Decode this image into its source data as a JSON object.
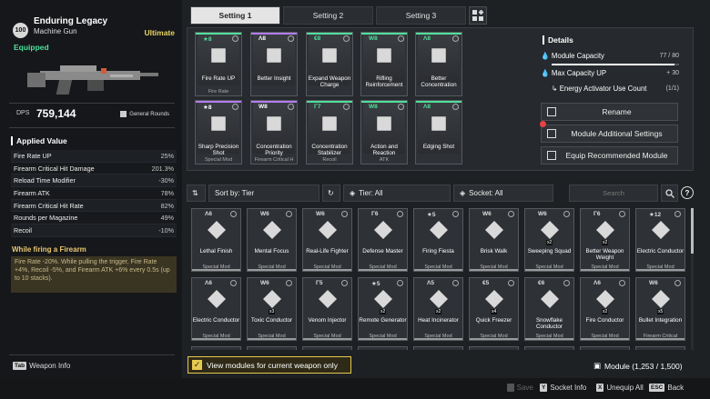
{
  "weapon": {
    "rank": "100",
    "name": "Enduring Legacy",
    "type": "Machine Gun",
    "tier": "Ultimate",
    "status": "Equipped",
    "dps_label": "DPS",
    "dps_value": "759,144",
    "ammo": "General Rounds"
  },
  "applied": {
    "title": "Applied Value",
    "stats": [
      {
        "label": "Fire Rate UP",
        "value": "25%"
      },
      {
        "label": "Firearm Critical Hit Damage",
        "value": "201.3%"
      },
      {
        "label": "Reload Time Modifier",
        "value": "-30%"
      },
      {
        "label": "Firearm ATK",
        "value": "78%"
      },
      {
        "label": "Firearm Critical Hit Rate",
        "value": "82%"
      },
      {
        "label": "Rounds per Magazine",
        "value": "49%"
      },
      {
        "label": "Recoil",
        "value": "-10%"
      }
    ],
    "firing_title": "While firing a Firearm",
    "firing_text": "Fire Rate -20%. While pulling the trigger, Fire Rate +4%, Recoil -5%, and Firearm ATK +6% every 0.5s (up to 10 stacks)."
  },
  "weapon_info": {
    "key": "Tab",
    "label": "Weapon Info"
  },
  "settings_tabs": [
    "Setting 1",
    "Setting 2",
    "Setting 3"
  ],
  "equipped_slots": [
    {
      "cap": "★8",
      "name": "Fire Rate UP",
      "sub": "Fire Rate",
      "color": "g"
    },
    {
      "cap": "Λ8",
      "name": "Better Insight",
      "sub": "",
      "color": "p"
    },
    {
      "cap": "€8",
      "name": "Expand Weapon Charge",
      "sub": "",
      "color": "g"
    },
    {
      "cap": "W8",
      "name": "Rifling Reinforcement",
      "sub": "",
      "color": "g"
    },
    {
      "cap": "Λ8",
      "name": "Better Concentration",
      "sub": "",
      "color": "g"
    },
    {
      "cap": "★8",
      "name": "Sharp Precision Shot",
      "sub": "Special Mod",
      "color": "p"
    },
    {
      "cap": "W8",
      "name": "Concentration Priority",
      "sub": "Firearm Critical H",
      "color": "p"
    },
    {
      "cap": "Γ7",
      "name": "Concentration Stabilizer",
      "sub": "Recoil",
      "color": "g"
    },
    {
      "cap": "W8",
      "name": "Action and Reaction",
      "sub": "ATK",
      "color": "g"
    },
    {
      "cap": "Λ8",
      "name": "Edging Shot",
      "sub": "",
      "color": "g"
    }
  ],
  "details": {
    "title": "Details",
    "module_capacity_label": "Module Capacity",
    "module_capacity_value": "77 / 80",
    "module_capacity_fraction": 0.9625,
    "max_capacity_label": "Max Capacity UP",
    "max_capacity_value": "+ 30",
    "activator_label": "Energy Activator Use Count",
    "activator_value": "(1/1)"
  },
  "actions": {
    "rename": "Rename",
    "additional": "Module Additional Settings",
    "recommend": "Equip Recommended Module"
  },
  "filters": {
    "sort": "Sort by: Tier",
    "tier": "Tier: All",
    "socket": "Socket: All",
    "search_placeholder": "Search"
  },
  "modules": [
    {
      "cap": "Λ6",
      "name": "Lethal Finish",
      "sub": "Special Mod",
      "qty": ""
    },
    {
      "cap": "W6",
      "name": "Mental Focus",
      "sub": "Special Mod",
      "qty": ""
    },
    {
      "cap": "W6",
      "name": "Real-Life Fighter",
      "sub": "Special Mod",
      "qty": ""
    },
    {
      "cap": "Γ6",
      "name": "Defense Master",
      "sub": "Special Mod",
      "qty": ""
    },
    {
      "cap": "★5",
      "name": "Firing Fiesta",
      "sub": "Special Mod",
      "qty": ""
    },
    {
      "cap": "W6",
      "name": "Brisk Walk",
      "sub": "Special Mod",
      "qty": ""
    },
    {
      "cap": "W6",
      "name": "Sweeping Squad",
      "sub": "Special Mod",
      "qty": "x2"
    },
    {
      "cap": "Γ6",
      "name": "Better Weapon Weight",
      "sub": "Special Mod",
      "qty": "x2"
    },
    {
      "cap": "★12",
      "name": "Electric Conductor",
      "sub": "Special Mod",
      "qty": ""
    },
    {
      "cap": "Λ6",
      "name": "Electric Conductor",
      "sub": "Special Mod",
      "qty": ""
    },
    {
      "cap": "W6",
      "name": "Toxic Conductor",
      "sub": "Special Mod",
      "qty": "x3"
    },
    {
      "cap": "Γ5",
      "name": "Venom Injector",
      "sub": "Special Mod",
      "qty": ""
    },
    {
      "cap": "★5",
      "name": "Remote Generator",
      "sub": "Special Mod",
      "qty": "x2"
    },
    {
      "cap": "Λ5",
      "name": "Heat Incinerator",
      "sub": "Special Mod",
      "qty": "x2"
    },
    {
      "cap": "€5",
      "name": "Quick Freezer",
      "sub": "Special Mod",
      "qty": "x4"
    },
    {
      "cap": "€6",
      "name": "Snowflake Conductor",
      "sub": "Special Mod",
      "qty": ""
    },
    {
      "cap": "Λ6",
      "name": "Fire Conductor",
      "sub": "Special Mod",
      "qty": "x2"
    },
    {
      "cap": "W6",
      "name": "Bullet Integration",
      "sub": "Firearm Critical",
      "qty": "x5"
    }
  ],
  "bottom": {
    "view_label": "View modules for current weapon only",
    "module_count": "Module (1,253 / 1,500)",
    "save": "Save",
    "socket_info": "Socket Info",
    "unequip": "Unequip All",
    "back": "Back",
    "key_y": "Y",
    "key_x": "X",
    "key_esc": "ESC"
  },
  "colors": {
    "accent_green": "#4fe09a",
    "ultimate_gold": "#e9d560",
    "firing_gold": "#e9c870",
    "check_gold": "#e5c84e"
  }
}
